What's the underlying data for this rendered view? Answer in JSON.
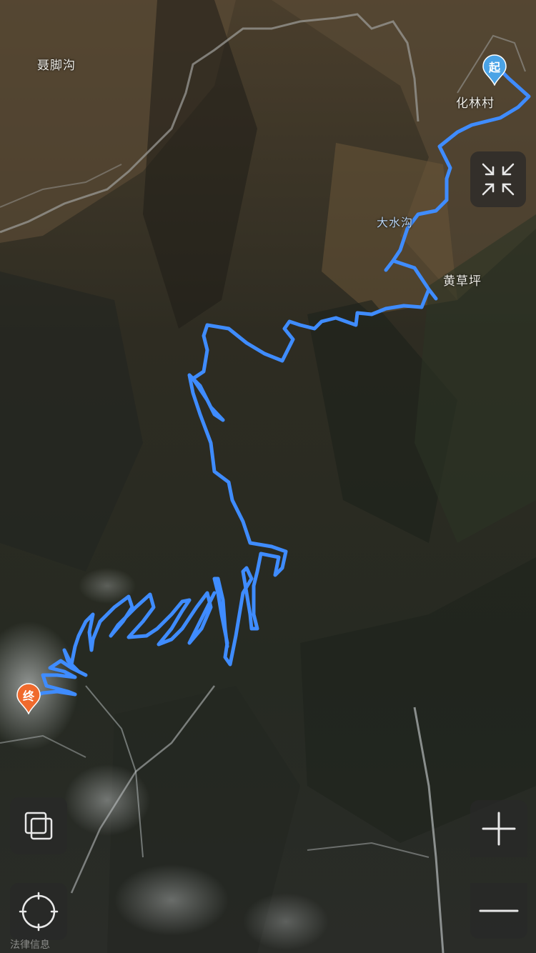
{
  "map": {
    "view": "satellite",
    "route_color": "#3f8cff",
    "places": [
      {
        "label": "聂脚沟",
        "kind": "place"
      },
      {
        "label": "化林村",
        "kind": "place"
      },
      {
        "label": "大水沟",
        "kind": "water"
      },
      {
        "label": "黄草坪",
        "kind": "place"
      }
    ],
    "start_marker": {
      "label": "起",
      "color": "#4aa3e6"
    },
    "end_marker": {
      "label": "终",
      "color": "#f06a2d"
    }
  },
  "controls": {
    "fullscreen_icon": "collapse-arrows-icon",
    "layers_icon": "layers-icon",
    "locate_icon": "crosshair-icon",
    "zoom_in_icon": "plus-icon",
    "zoom_out_icon": "minus-icon"
  },
  "footer": {
    "legal_label": "法律信息"
  }
}
